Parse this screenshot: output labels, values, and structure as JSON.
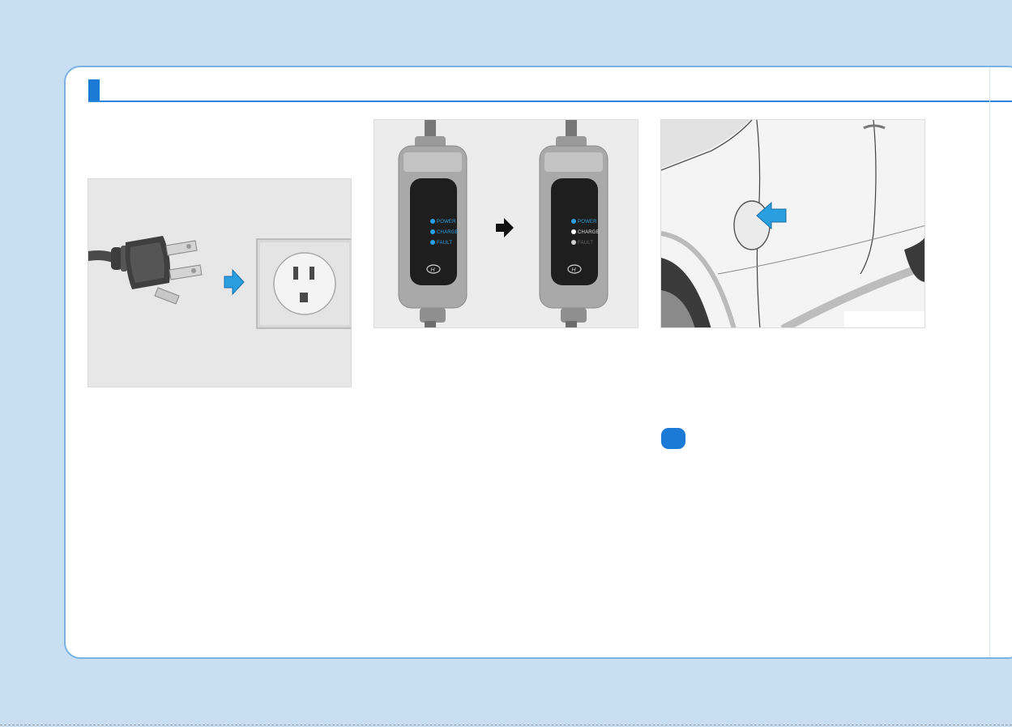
{
  "led_panel_left": {
    "power": "POWER",
    "charge": "CHARGE",
    "fault": "FAULT"
  },
  "led_panel_right": {
    "power": "POWER",
    "charge": "CHARGE",
    "fault": "FAULT"
  },
  "icons": {
    "plug": "power-plug-icon",
    "outlet": "wall-outlet-icon",
    "arrow": "right-arrow-icon",
    "brand": "hyundai-logo-icon",
    "step": "step-badge-icon"
  },
  "colors": {
    "accent": "#1a7ad6",
    "frame": "#7ab3e3",
    "background": "#c8dff2",
    "led_blue": "#2a9fe0"
  }
}
